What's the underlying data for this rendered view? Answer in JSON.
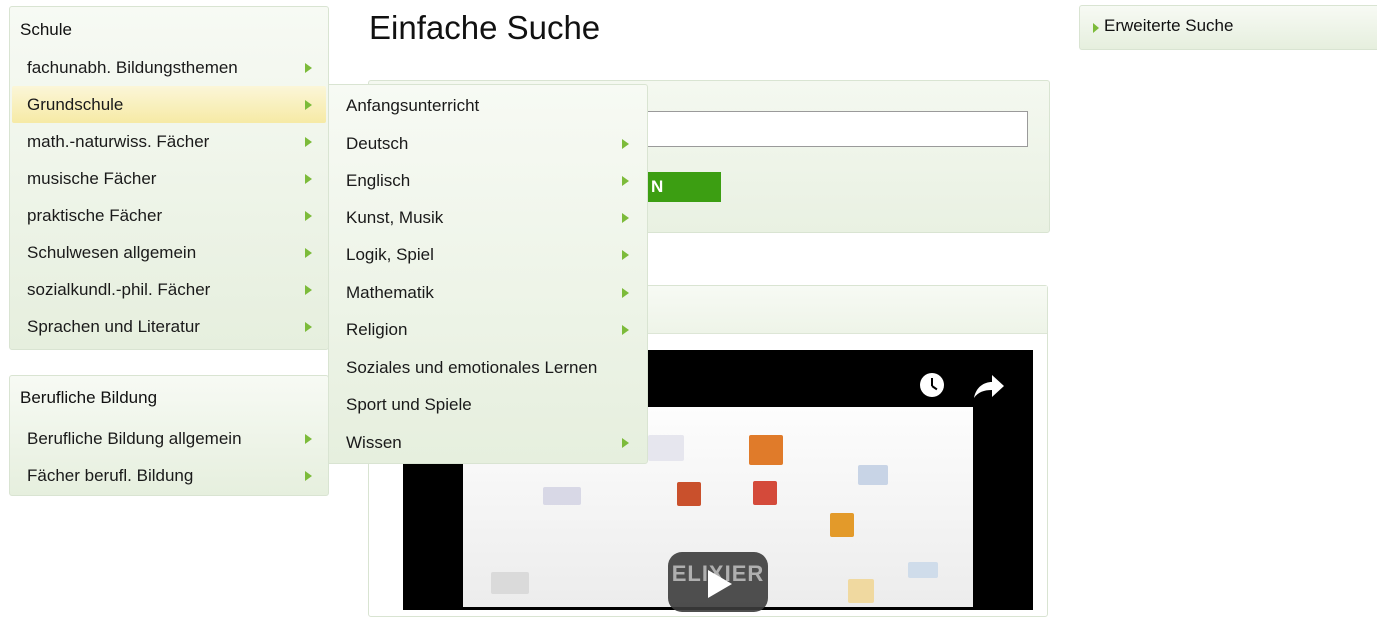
{
  "page_title": "Einfache Suche",
  "advanced_search": {
    "label": "Erweiterte Suche"
  },
  "schule": {
    "title": "Schule",
    "items": [
      {
        "label": "fachunabh. Bildungsthemen",
        "has_submenu": true
      },
      {
        "label": "Grundschule",
        "has_submenu": true,
        "active": true
      },
      {
        "label": "math.-naturwiss. Fächer",
        "has_submenu": true
      },
      {
        "label": "musische Fächer",
        "has_submenu": true
      },
      {
        "label": "praktische Fächer",
        "has_submenu": true
      },
      {
        "label": "Schulwesen allgemein",
        "has_submenu": true
      },
      {
        "label": "sozialkundl.-phil. Fächer",
        "has_submenu": true
      },
      {
        "label": "Sprachen und Literatur",
        "has_submenu": true
      }
    ]
  },
  "berufliche": {
    "title": "Berufliche Bildung",
    "items": [
      {
        "label": "Berufliche Bildung allgemein",
        "has_submenu": true
      },
      {
        "label": "Fächer berufl. Bildung",
        "has_submenu": true
      }
    ]
  },
  "grundschule_submenu": {
    "items": [
      {
        "label": "Anfangsunterricht",
        "has_submenu": false
      },
      {
        "label": "Deutsch",
        "has_submenu": true
      },
      {
        "label": "Englisch",
        "has_submenu": true
      },
      {
        "label": "Kunst, Musik",
        "has_submenu": true
      },
      {
        "label": "Logik, Spiel",
        "has_submenu": true
      },
      {
        "label": "Mathematik",
        "has_submenu": true
      },
      {
        "label": "Religion",
        "has_submenu": true
      },
      {
        "label": "Soziales und emotionales Lernen",
        "has_submenu": false
      },
      {
        "label": "Sport und Spiele",
        "has_submenu": false
      },
      {
        "label": "Wissen",
        "has_submenu": true
      }
    ]
  },
  "search": {
    "button_label_visible": "N",
    "input_value": ""
  },
  "video": {
    "watermark": "ELIXIER",
    "icons": [
      "clock-icon",
      "share-icon",
      "play-icon"
    ]
  },
  "colors": {
    "accent_green": "#3c9e12",
    "arrow_green": "#7cbb3a",
    "active_yellow": "#f6eaa5"
  }
}
